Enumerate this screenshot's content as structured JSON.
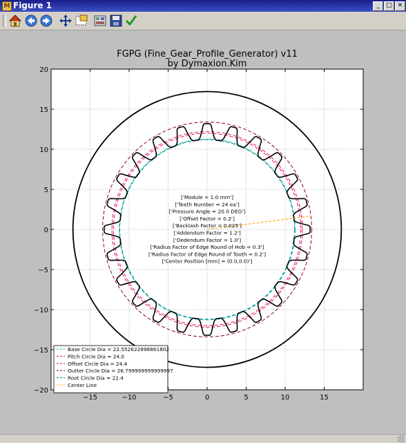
{
  "window": {
    "title": "Figure 1"
  },
  "window_buttons": {
    "minimize": "_",
    "maximize": "□",
    "close": "✕"
  },
  "toolbar": {
    "buttons": [
      {
        "name": "home",
        "icon": "home-icon"
      },
      {
        "name": "back",
        "icon": "back-arrow-icon"
      },
      {
        "name": "forward",
        "icon": "forward-arrow-icon"
      },
      {
        "name": "pan",
        "icon": "move-arrows-icon"
      },
      {
        "name": "zoom",
        "icon": "zoom-rect-icon"
      },
      {
        "name": "subplots",
        "icon": "subplots-config-icon"
      },
      {
        "name": "save",
        "icon": "save-floppy-icon"
      },
      {
        "name": "edit",
        "icon": "checkmark-icon"
      }
    ]
  },
  "colors": {
    "base": "#00bfbf",
    "pitch": "#ff0080",
    "offset": "#cc2244",
    "outter": "#880022",
    "root": "#008080",
    "center": "#ffa000",
    "gear": "#000000",
    "frame": "#000000"
  },
  "chart_data": {
    "type": "line",
    "title": "FGPG (Fine_Gear_Profile_Generator) v11",
    "subtitle": "by Dymaxion.Kim",
    "xlim": [
      -20,
      20
    ],
    "ylim": [
      -20,
      20
    ],
    "xticks": [
      -15,
      -10,
      -5,
      0,
      5,
      10,
      15
    ],
    "yticks": [
      -20,
      -15,
      -10,
      -5,
      0,
      5,
      10,
      15,
      20
    ],
    "xtick_labels": [
      "−15",
      "−10",
      "−5",
      "0",
      "5",
      "10",
      "15"
    ],
    "ytick_labels": [
      "−20",
      "−15",
      "−10",
      "−5",
      "0",
      "5",
      "10",
      "15",
      "20"
    ],
    "grid": true,
    "legend_position": "lower-left",
    "gear": {
      "teeth": 24,
      "module": 1.0,
      "outer_radius": 13.2,
      "root_radius": 11.2
    },
    "housing_radius": 17.2,
    "circles": [
      {
        "name": "Base Circle Dia = 22.552622898861802",
        "diameter": 22.552622898861802,
        "color": "base"
      },
      {
        "name": "Pitch Circle Dia = 24.0",
        "diameter": 24.0,
        "color": "pitch"
      },
      {
        "name": "Offset Circle Dia = 24.4",
        "diameter": 24.4,
        "color": "offset"
      },
      {
        "name": "Outter Circle Dia = 26.799999999999997",
        "diameter": 26.8,
        "color": "outter"
      },
      {
        "name": "Root Circle Dia = 22.4",
        "diameter": 22.4,
        "color": "root"
      }
    ],
    "center_line": {
      "name": "Center Line",
      "from": [
        0,
        0
      ],
      "to": [
        13.4,
        1.7
      ],
      "color": "center"
    },
    "annotations": [
      "['Module = 1.0 mm']",
      "['Teeth Number = 24 ea']",
      "['Pressure Angle = 20.0 DEG']",
      "['Offset Factor = 0.2']",
      "['Backlash Factor = 0.025']",
      "['Addendum Factor = 1.2']",
      "['Dedendum Factor = 1.0']",
      "['Radius Factor of Edge Round of Hob = 0.3']",
      "['Radius Factor of Edge Round of Tooth = 0.2']",
      "['Center Position [mm] = (0.0,0.0)']"
    ]
  }
}
